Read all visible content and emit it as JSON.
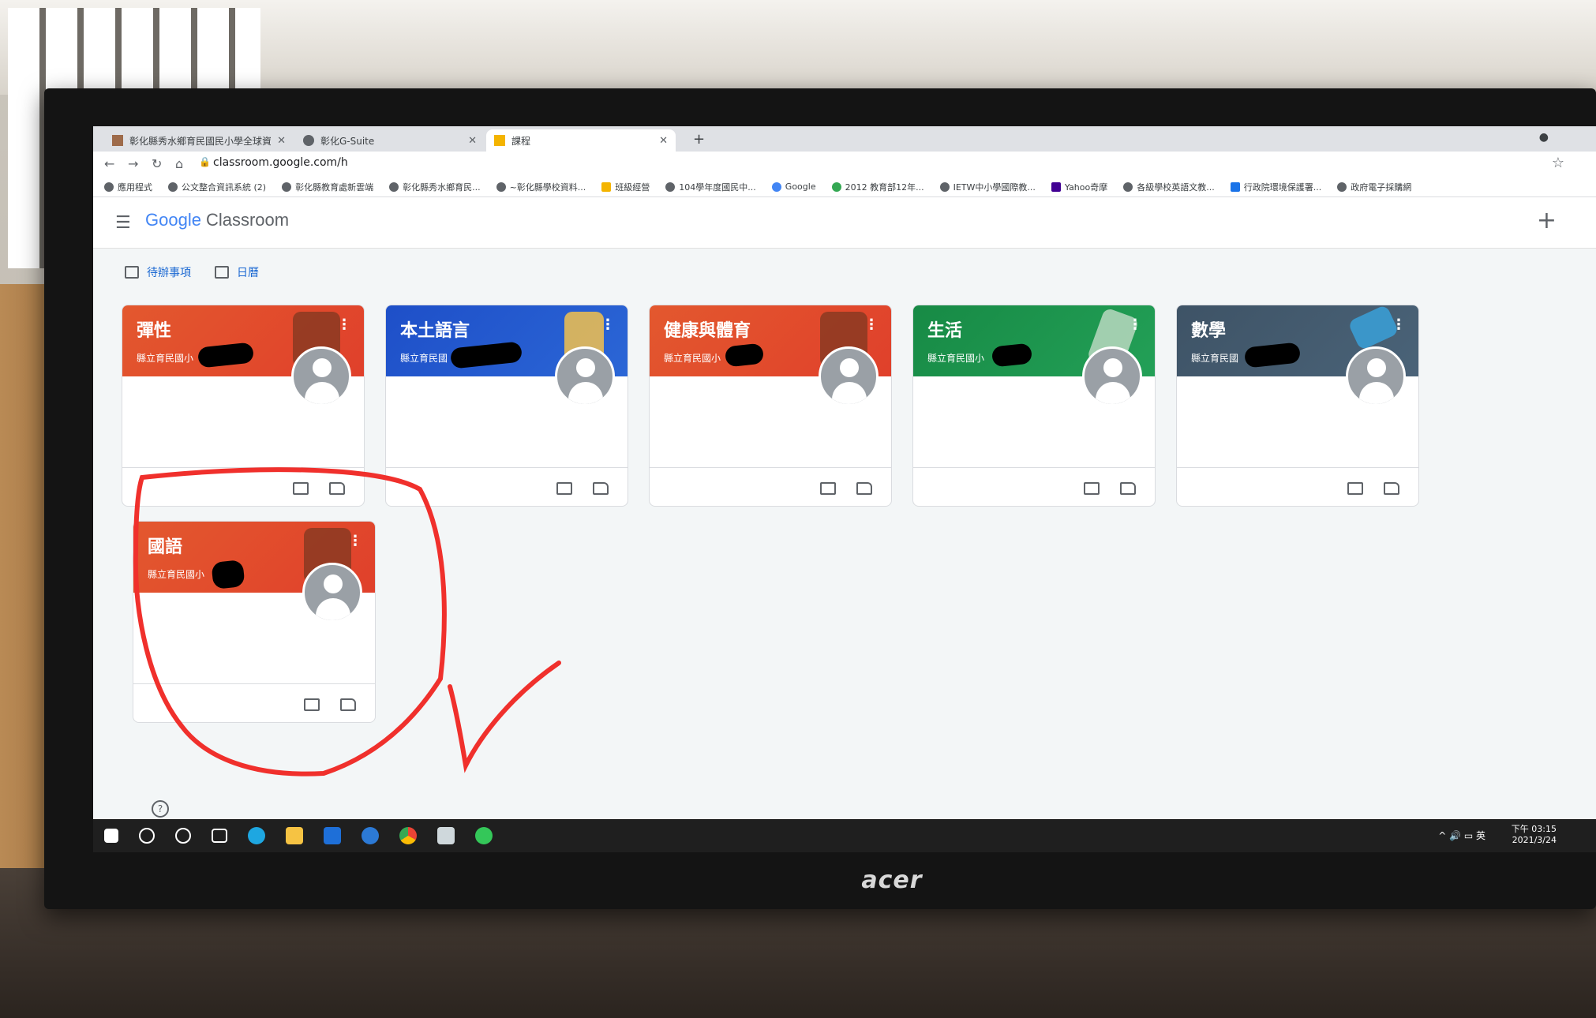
{
  "browser": {
    "tabs": [
      {
        "label": "彰化縣秀水鄉育民國民小學全球資訊網"
      },
      {
        "label": "彰化G-Suite"
      },
      {
        "label": "課程"
      }
    ],
    "url": "classroom.google.com/h",
    "bookmarks": [
      "應用程式",
      "公文整合資訊系統 (2)",
      "彰化縣教育處新雲端",
      "彰化縣秀水鄉育民...",
      "~彰化縣學校資料...",
      "班級經營",
      "104學年度國民中...",
      "Google",
      "2012 教育部12年...",
      "IETW中小學國際教...",
      "Yahoo奇摩",
      "各級學校英語文教...",
      "行政院環境保護署...",
      "政府電子採購網"
    ]
  },
  "app": {
    "logo_google": "Google",
    "logo_product": "Classroom",
    "todo": "待辦事項",
    "calendar": "日曆"
  },
  "courses": [
    {
      "title": "彈性",
      "section": "縣立育民國小",
      "color": "#e3582e"
    },
    {
      "title": "本土語言",
      "section": "縣立育民國",
      "color": "#1e4fc8"
    },
    {
      "title": "健康與體育",
      "section": "縣立育民國小",
      "color": "#e3582e"
    },
    {
      "title": "生活",
      "section": "縣立育民國小",
      "color": "#178a45"
    },
    {
      "title": "數學",
      "section": "縣立育民國",
      "color": "#3e5366"
    },
    {
      "title": "國語",
      "section": "縣立育民國小",
      "color": "#e3582e"
    }
  ],
  "taskbar": {
    "time": "下午 03:15",
    "date": "2021/3/24",
    "ime": "英"
  },
  "monitor": {
    "brand": "acer"
  },
  "annotation": {
    "color": "#f0302c"
  }
}
